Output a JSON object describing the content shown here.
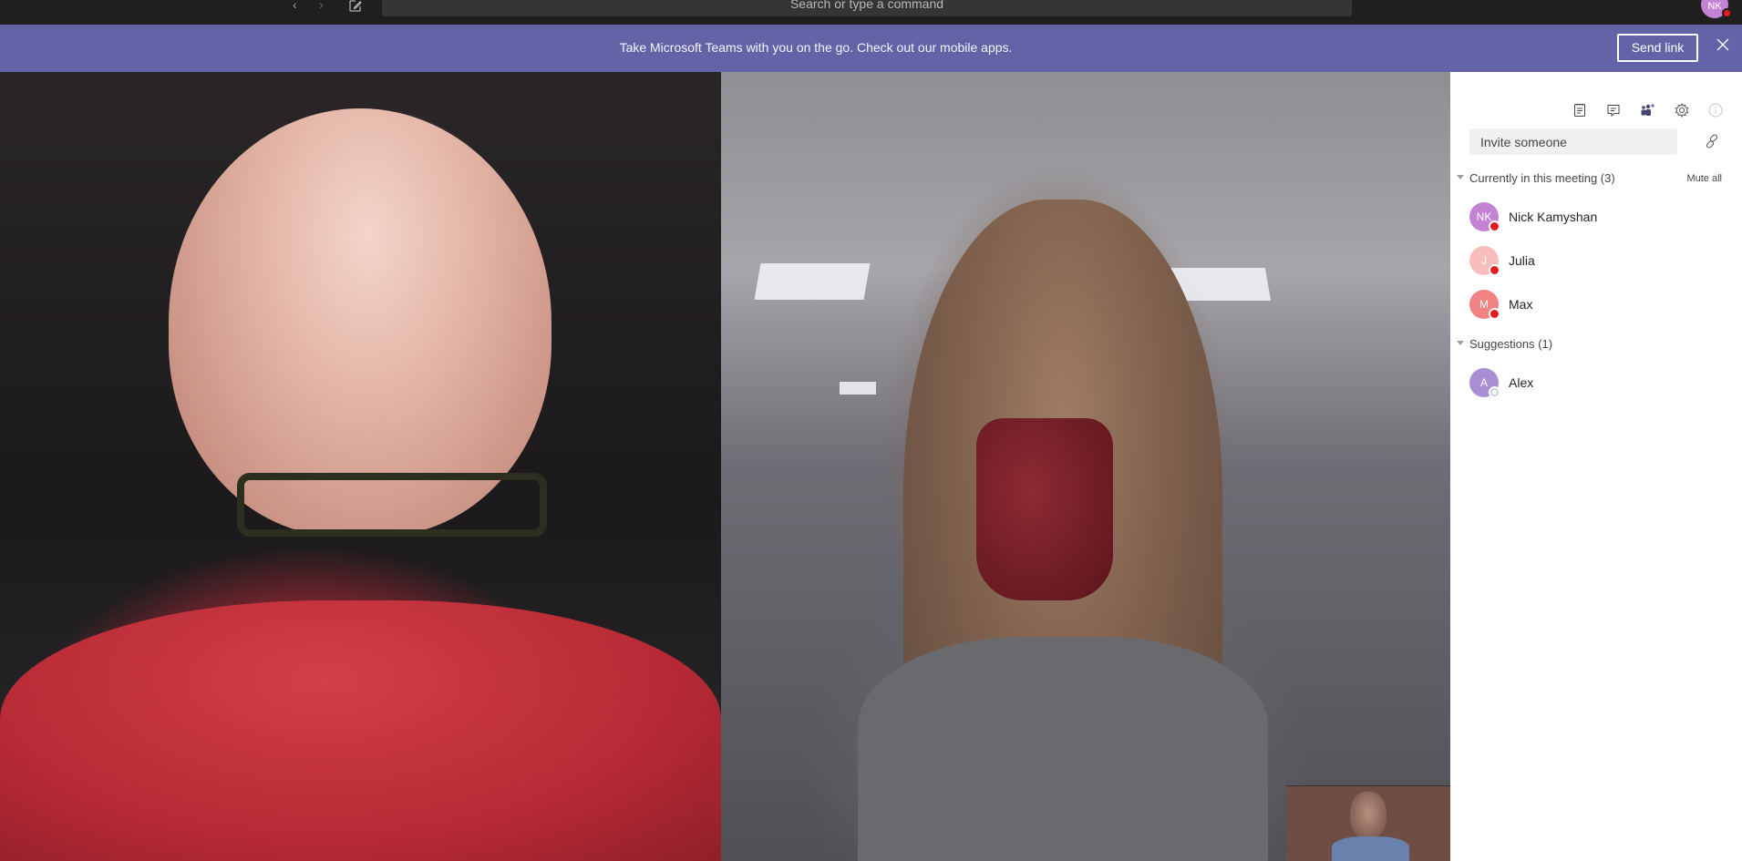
{
  "topbar": {
    "back_icon": "chevron-left-icon",
    "forward_icon": "chevron-right-icon",
    "compose_icon": "compose-icon",
    "search_placeholder": "Search or type a command",
    "user_initials": "NK",
    "user_avatar_color": "#c382d3",
    "user_status": "busy"
  },
  "banner": {
    "message": "Take Microsoft Teams with you on the go. Check out our mobile apps.",
    "send_link_label": "Send link",
    "close_icon": "close-icon",
    "background": "#6264a7"
  },
  "video": {
    "main_participants": [
      "Participant video 1",
      "Participant video 2"
    ],
    "self_view": "Self view"
  },
  "panel": {
    "toolbar_icons": [
      "meeting-notes-icon",
      "chat-icon",
      "add-people-icon",
      "settings-icon",
      "info-icon"
    ],
    "invite_placeholder": "Invite someone",
    "copy_link_icon": "link-icon",
    "in_meeting": {
      "title": "Currently in this meeting",
      "count": "(3)",
      "mute_all_label": "Mute all",
      "people": [
        {
          "initials": "NK",
          "name": "Nick Kamyshan",
          "color": "#c382d3",
          "status": "busy"
        },
        {
          "initials": "J",
          "name": "Julia",
          "color": "#f7bdbd",
          "status": "busy"
        },
        {
          "initials": "M",
          "name": "Max",
          "color": "#f08282",
          "status": "busy"
        }
      ]
    },
    "suggestions": {
      "title": "Suggestions",
      "count": "(1)",
      "people": [
        {
          "initials": "A",
          "name": "Alex",
          "color": "#a98ed1",
          "status": "offline"
        }
      ]
    }
  }
}
